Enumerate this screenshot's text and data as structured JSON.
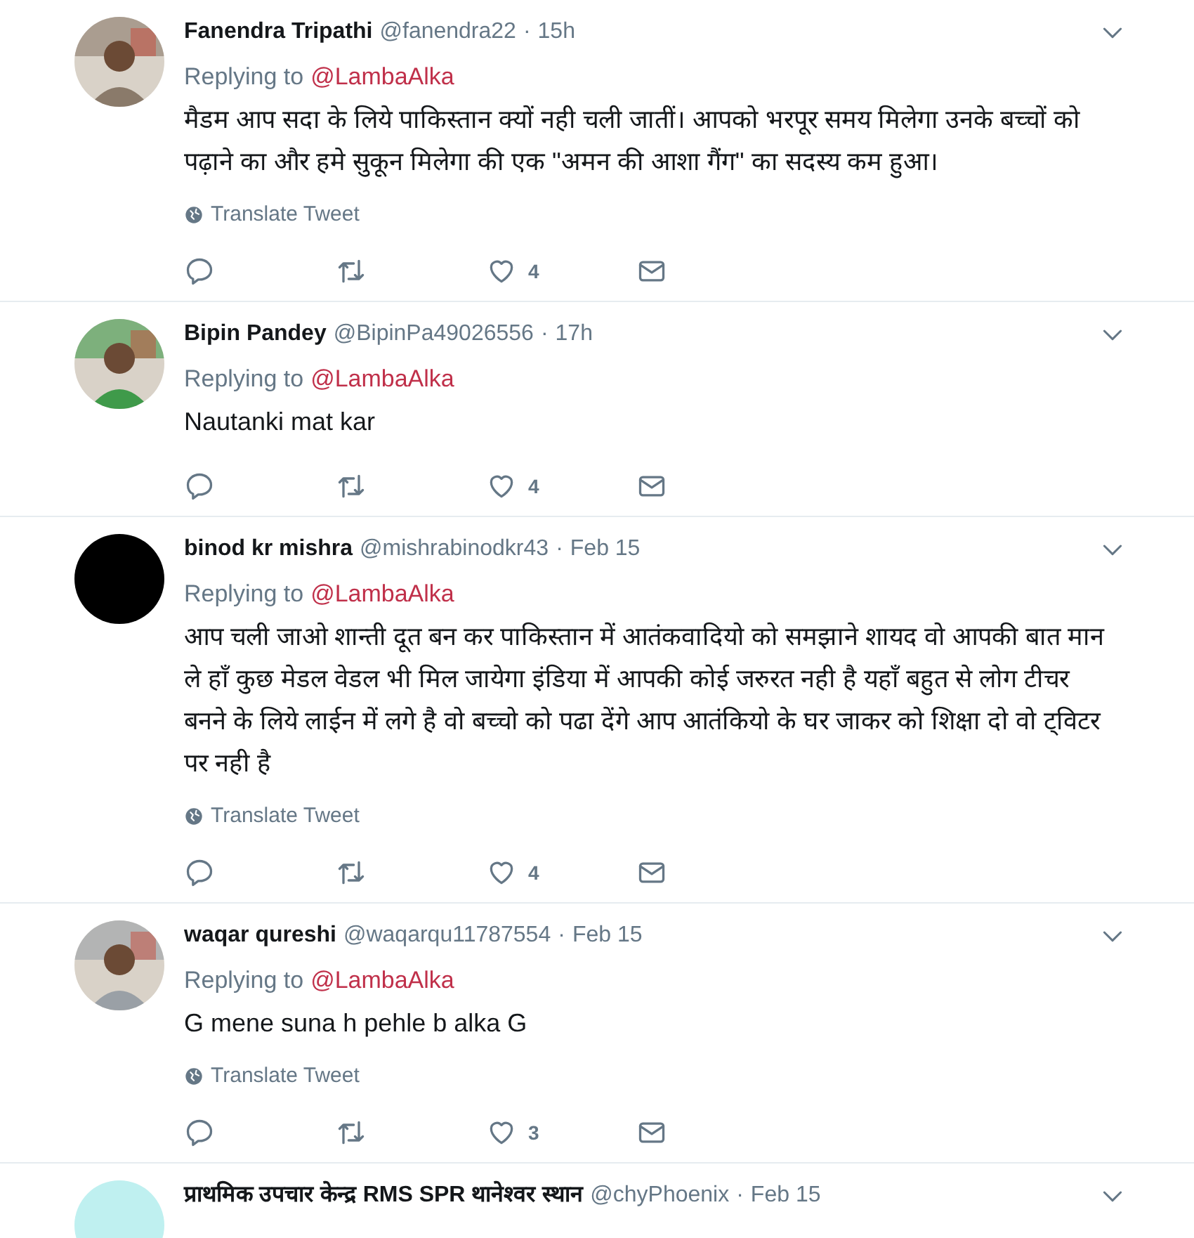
{
  "tweets": [
    {
      "avatar": {
        "kind": "photo",
        "color": "#8a7a6a"
      },
      "name": "Fanendra Tripathi",
      "handle": "@fanendra22",
      "dot": "·",
      "time": "15h",
      "replying_label": "Replying to",
      "replying_to": "@LambaAlka",
      "text": "मैडम आप सदा के लिये पाकिस्तान क्यों नही चली जातीं। आपको भरपूर समय मिलेगा उनके बच्चों को पढ़ाने का और हमे सुकून मिलेगा की एक \"अमन की आशा गैंग\" का सदस्य कम हुआ।",
      "translate": "Translate Tweet",
      "likes": "4"
    },
    {
      "avatar": {
        "kind": "photo",
        "color": "#3f9a4a"
      },
      "name": "Bipin Pandey",
      "handle": "@BipinPa49026556",
      "dot": "·",
      "time": "17h",
      "replying_label": "Replying to",
      "replying_to": "@LambaAlka",
      "text": "Nautanki mat kar",
      "likes": "4"
    },
    {
      "avatar": {
        "kind": "blank",
        "color": "#000000"
      },
      "name": "binod kr mishra",
      "handle": "@mishrabinodkr43",
      "dot": "·",
      "time": "Feb 15",
      "replying_label": "Replying to",
      "replying_to": "@LambaAlka",
      "text": "आप चली जाओ शान्ती दूत बन कर पाकिस्तान में आतंकवादियो को समझाने शायद वो आपकी बात मान ले हाँ कुछ मेडल वेडल भी मिल जायेगा इंडिया में आपकी कोई जरुरत नही है यहाँ बहुत से लोग टीचर बनने के लिये लाईन में लगे है वो बच्चो को पढा देंगे आप आतंकियो के घर जाकर को शिक्षा दो वो ट्विटर पर नही है",
      "translate": "Translate Tweet",
      "likes": "4"
    },
    {
      "avatar": {
        "kind": "photo",
        "color": "#9aa0a6"
      },
      "name": "waqar qureshi",
      "handle": "@waqarqu11787554",
      "dot": "·",
      "time": "Feb 15",
      "replying_label": "Replying to",
      "replying_to": "@LambaAlka",
      "text": "G mene suna h pehle b alka G",
      "translate": "Translate Tweet",
      "likes": "3"
    },
    {
      "avatar": {
        "kind": "blank",
        "color": "#bff0f0"
      },
      "name": "प्राथमिक उपचार केन्द्र RMS SPR थानेश्वर स्थान",
      "handle": "@chyPhoenix",
      "dot": "·",
      "time": "Feb 15"
    }
  ]
}
